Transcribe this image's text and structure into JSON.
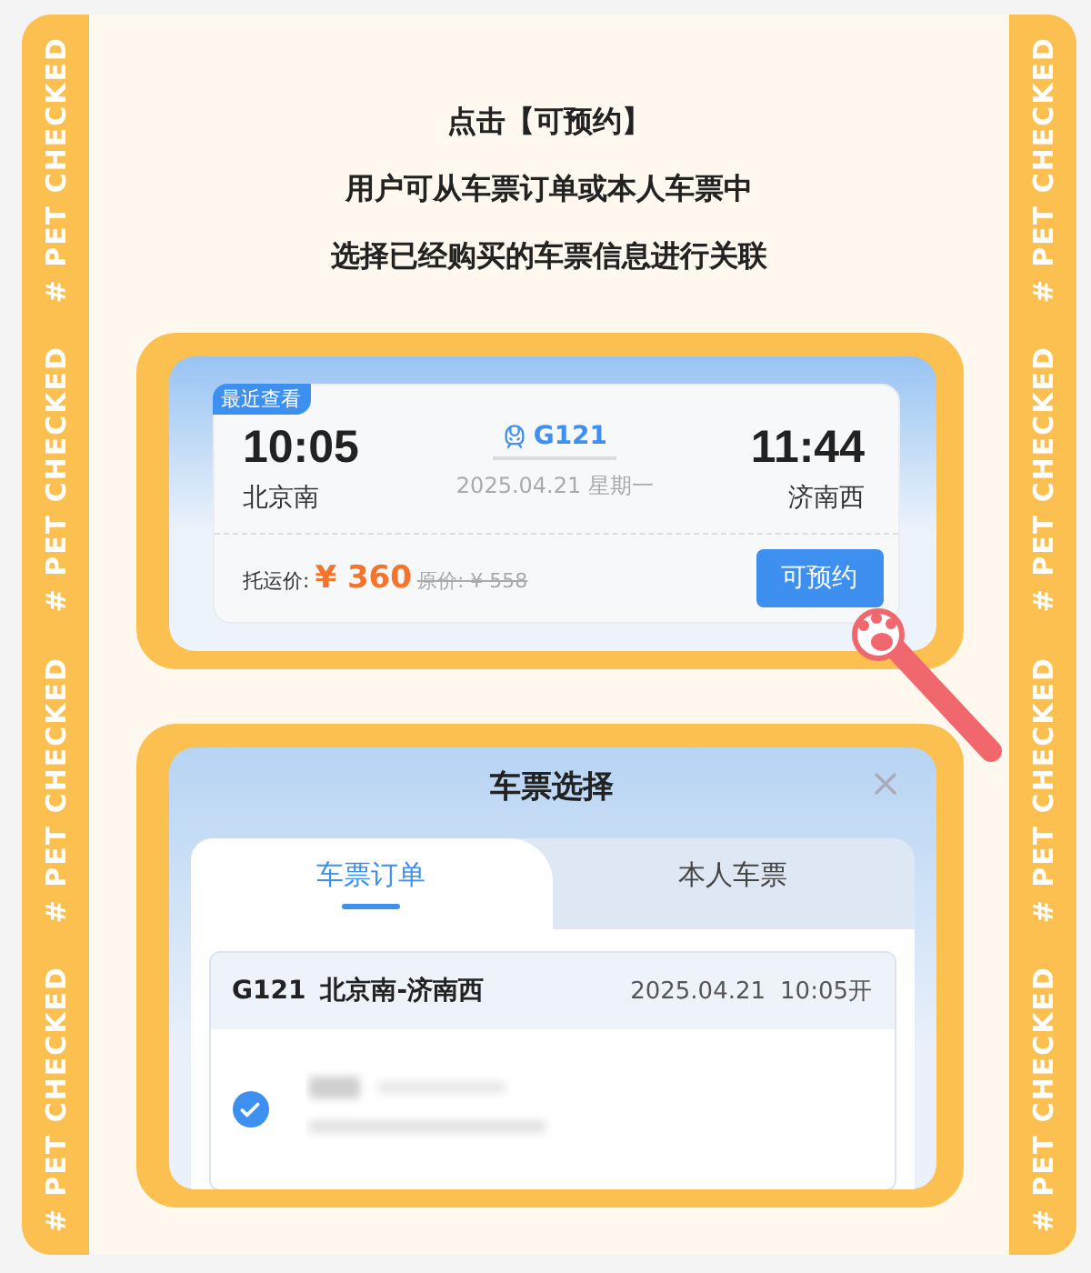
{
  "side_labels_left": [
    "# PET CHECKED",
    "# PET CHECKED",
    "# PET CHECKED",
    "# PET CHECKED"
  ],
  "side_labels_right": [
    "# PET CHECKED",
    "# PET CHECKED",
    "# PET CHECKED",
    "# PET CHECKED"
  ],
  "intro": [
    "点击【可预约】",
    "用户可从车票订单或本人车票中",
    "选择已经购买的车票信息进行关联"
  ],
  "ticket_card": {
    "badge": "最近查看",
    "depart_time": "10:05",
    "depart_station": "北京南",
    "train": "G121",
    "date": "2025.04.21 星期一",
    "arrive_time": "11:44",
    "arrive_station": "济南西",
    "price_label": "托运价:",
    "price": "¥ 360",
    "original_price": "原价: ¥ 558",
    "button": "可预约"
  },
  "dialog": {
    "title": "车票选择",
    "tabs": [
      {
        "label": "车票订单",
        "selected": true
      },
      {
        "label": "本人车票",
        "selected": false
      }
    ],
    "order": {
      "train": "G121",
      "route": "北京南-济南西",
      "date": "2025.04.21",
      "time": "10:05开",
      "checked": true
    }
  }
}
